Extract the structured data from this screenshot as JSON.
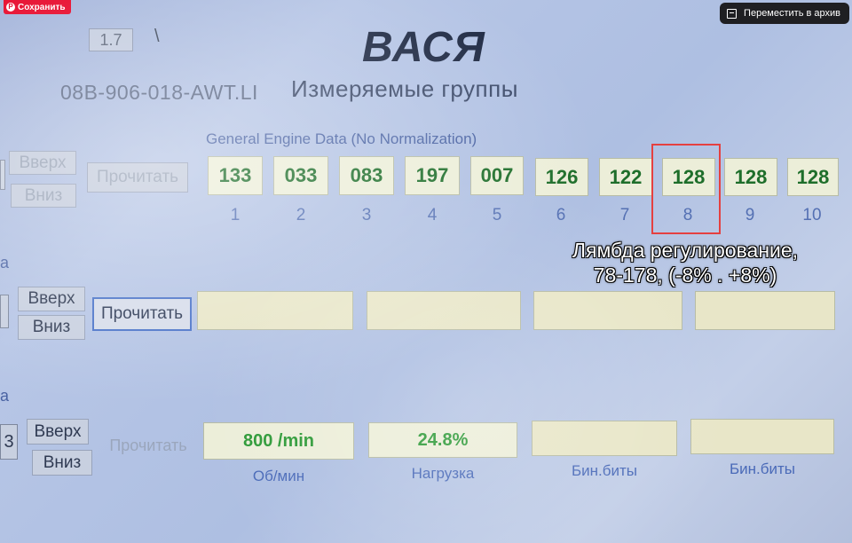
{
  "overlay": {
    "save_label": "Сохранить",
    "archive_label": "Переместить в архив"
  },
  "header": {
    "version": "1.7",
    "slash": "\\",
    "logo": "ВАСЯ",
    "file_id": "08B-906-018-AWT.LI",
    "title": "Измеряемые группы"
  },
  "group1": {
    "title": "General Engine Data (No Normalization)",
    "up_label": "Вверх",
    "down_label": "Вниз",
    "read_label": "Прочитать",
    "values": [
      "133",
      "033",
      "083",
      "197",
      "007",
      "126",
      "122",
      "128",
      "128",
      "128"
    ],
    "indices": [
      "1",
      "2",
      "3",
      "4",
      "5",
      "6",
      "7",
      "8",
      "9",
      "10"
    ],
    "highlighted_index": 8
  },
  "annotation": {
    "line1": "Лямбда регулирование,",
    "line2": "78-178, (-8% . +8%)"
  },
  "group2": {
    "side_label": "а",
    "up_label": "Вверх",
    "down_label": "Вниз",
    "read_label": "Прочитать"
  },
  "group3": {
    "side_label": "а",
    "group_number": "3",
    "up_label": "Вверх",
    "down_label": "Вниз",
    "read_label": "Прочитать",
    "results": [
      {
        "value": "800 /min",
        "unit": "Об/мин"
      },
      {
        "value": "24.8%",
        "unit": "Нагрузка"
      },
      {
        "value": "",
        "unit": "Бин.биты"
      },
      {
        "value": "",
        "unit": "Бин.биты"
      }
    ]
  },
  "colors": {
    "value_green": "#1e6e2a",
    "highlight_red": "#e54040",
    "label_blue": "#4a63a3"
  }
}
